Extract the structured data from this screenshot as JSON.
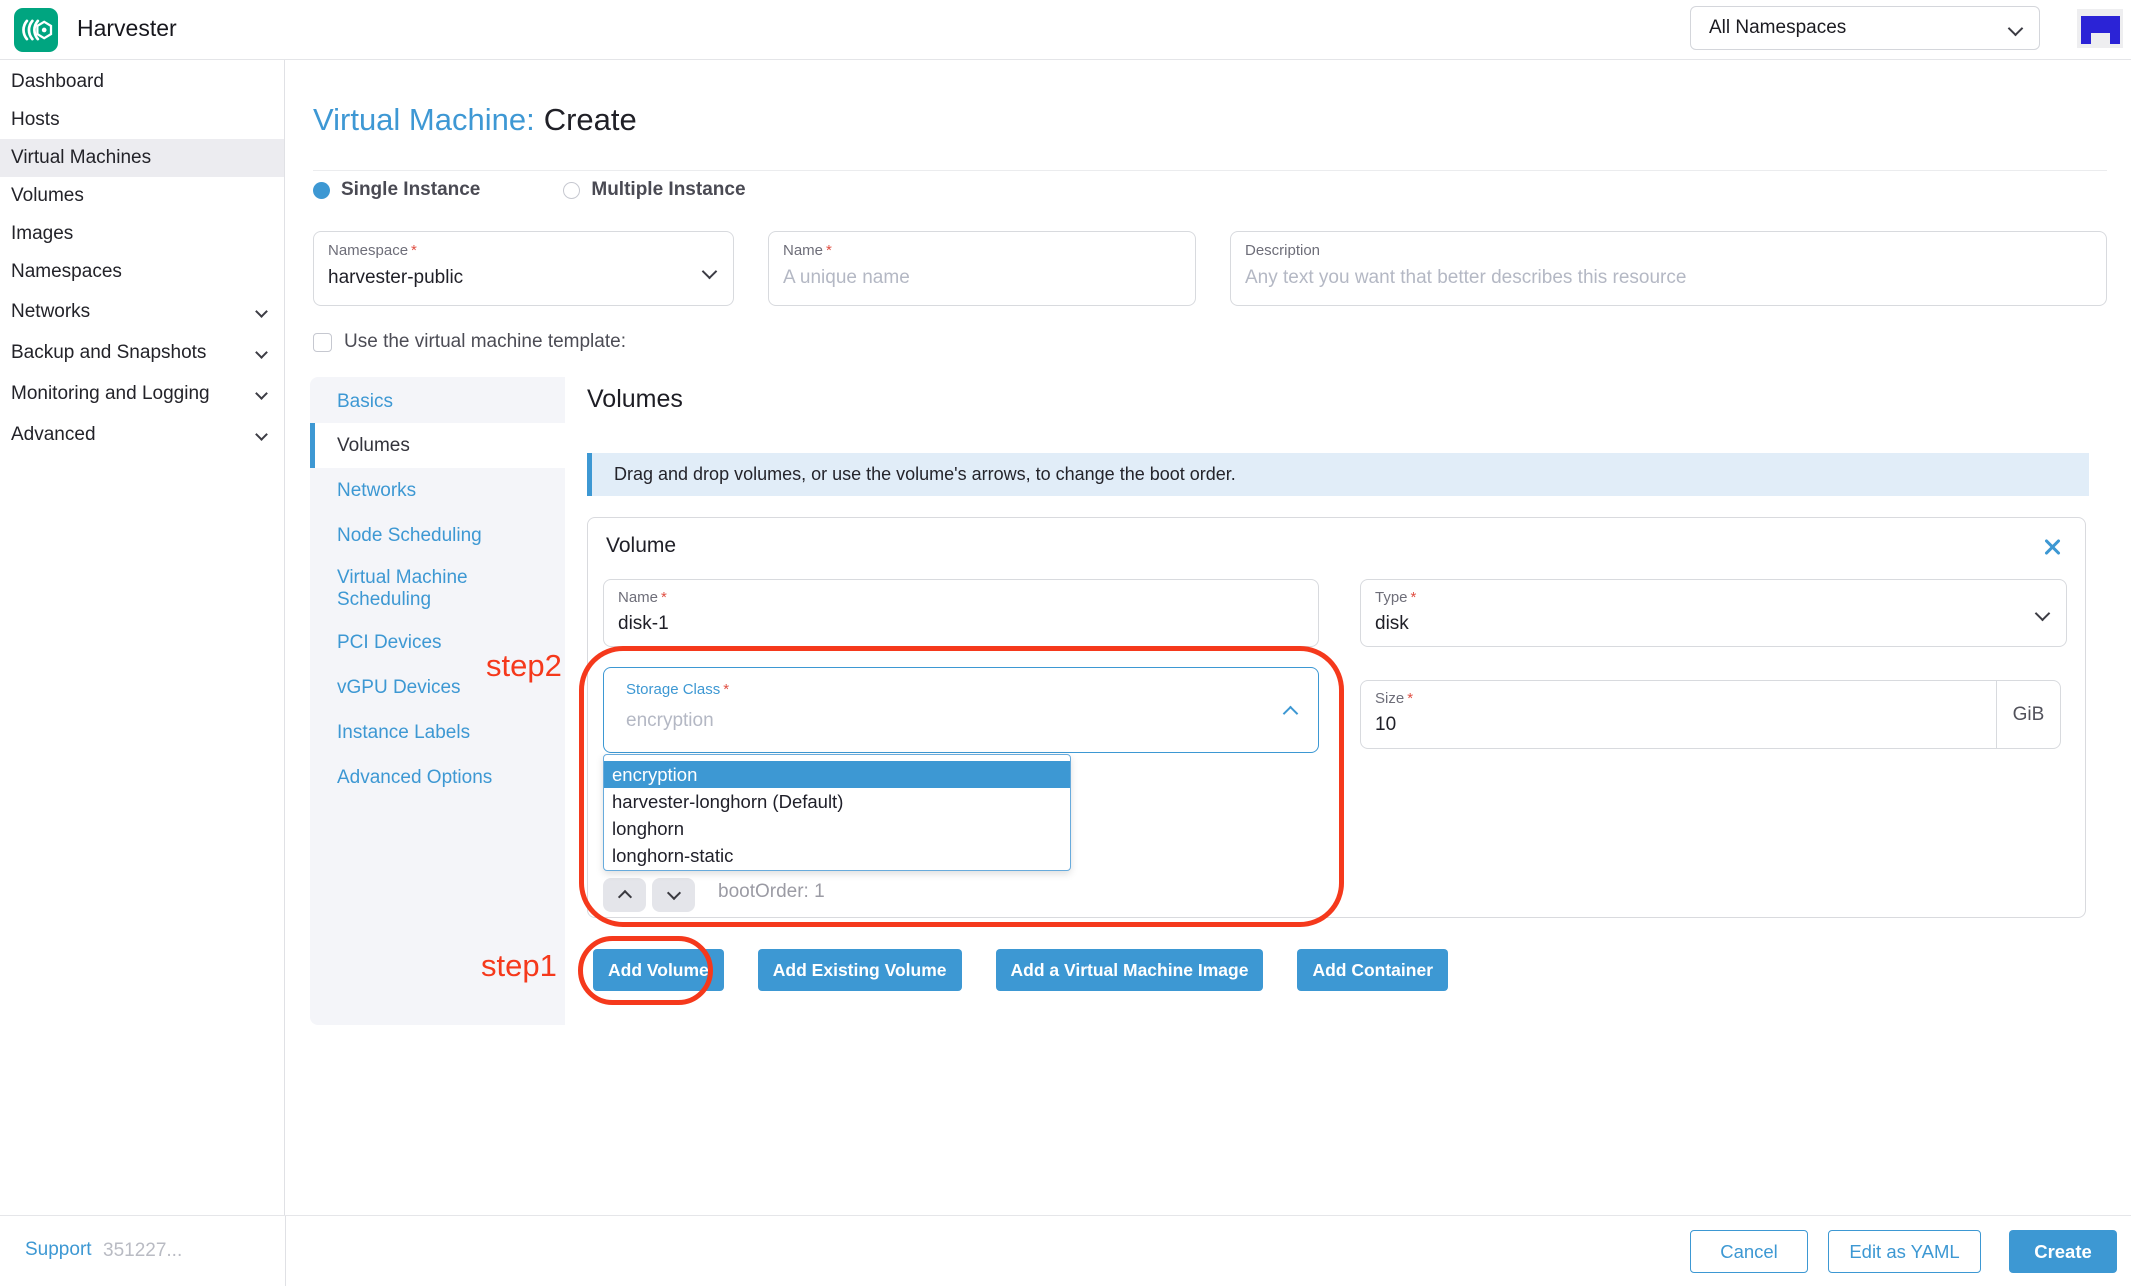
{
  "header": {
    "app_name": "Harvester",
    "namespace_filter": "All Namespaces"
  },
  "sidebar": {
    "items": [
      {
        "label": "Dashboard"
      },
      {
        "label": "Hosts"
      },
      {
        "label": "Virtual Machines",
        "active": true
      },
      {
        "label": "Volumes"
      },
      {
        "label": "Images"
      },
      {
        "label": "Namespaces"
      },
      {
        "label": "Networks",
        "expandable": true
      },
      {
        "label": "Backup and Snapshots",
        "expandable": true
      },
      {
        "label": "Monitoring and Logging",
        "expandable": true
      },
      {
        "label": "Advanced",
        "expandable": true
      }
    ],
    "support_label": "Support",
    "version": "351227..."
  },
  "page": {
    "title_prefix": "Virtual Machine:",
    "title_action": "Create",
    "instance_mode": {
      "single_label": "Single Instance",
      "multiple_label": "Multiple Instance",
      "selected": "Single Instance"
    },
    "namespace_field": {
      "label": "Namespace",
      "value": "harvester-public"
    },
    "name_field": {
      "label": "Name",
      "placeholder": "A unique name"
    },
    "description_field": {
      "label": "Description",
      "placeholder": "Any text you want that better describes this resource"
    },
    "template_checkbox_label": "Use the virtual machine template:"
  },
  "tabs": [
    {
      "label": "Basics"
    },
    {
      "label": "Volumes",
      "active": true
    },
    {
      "label": "Networks"
    },
    {
      "label": "Node Scheduling"
    },
    {
      "label": "Virtual Machine Scheduling"
    },
    {
      "label": "PCI Devices"
    },
    {
      "label": "vGPU Devices"
    },
    {
      "label": "Instance Labels"
    },
    {
      "label": "Advanced Options"
    }
  ],
  "volumes": {
    "heading": "Volumes",
    "banner_text": "Drag and drop volumes, or use the volume's arrows, to change the boot order.",
    "card": {
      "title": "Volume",
      "name_field": {
        "label": "Name",
        "value": "disk-1"
      },
      "type_field": {
        "label": "Type",
        "value": "disk"
      },
      "storage_class_field": {
        "label": "Storage Class",
        "placeholder": "encryption"
      },
      "size_field": {
        "label": "Size",
        "value": "10",
        "unit": "GiB"
      },
      "boot_order_text": "bootOrder: 1",
      "storage_class_options": [
        {
          "label": "encryption",
          "highlighted": true
        },
        {
          "label": "harvester-longhorn (Default)"
        },
        {
          "label": "longhorn"
        },
        {
          "label": "longhorn-static"
        }
      ]
    },
    "buttons": {
      "add_volume": "Add Volume",
      "add_existing_volume": "Add Existing Volume",
      "add_vm_image": "Add a Virtual Machine Image",
      "add_container": "Add Container"
    }
  },
  "annotations": {
    "step1": "step1",
    "step2": "step2"
  },
  "footer": {
    "cancel": "Cancel",
    "edit_yaml": "Edit as YAML",
    "create": "Create"
  },
  "misc": {
    "required_marker": "*"
  },
  "colors": {
    "accent_blue": "#3d98d3",
    "logo_green": "#00a580",
    "annotation_red": "#f5391c",
    "banner_bg": "#e1edf8",
    "avatar_blue": "#2b23d6",
    "sidebar_active_bg": "#ececf0"
  }
}
